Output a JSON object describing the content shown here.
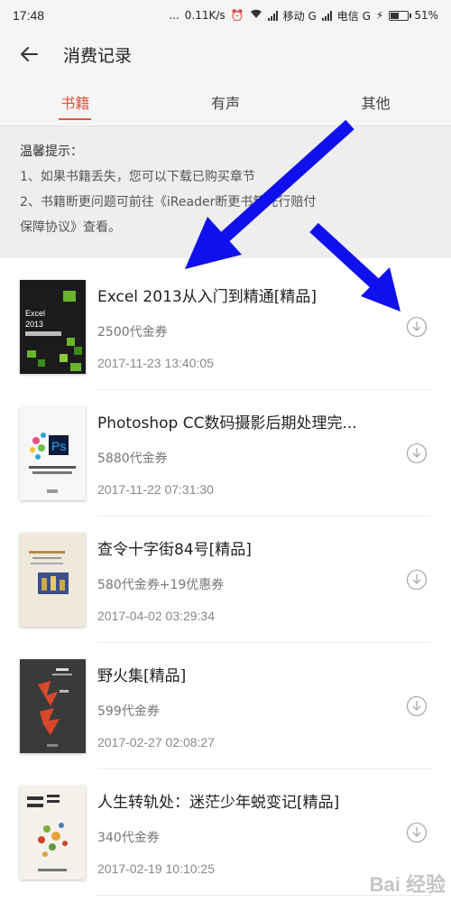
{
  "status_bar": {
    "time": "17:48",
    "dots": "...",
    "speed": "0.11K/s",
    "carrier1": "移动 G",
    "carrier2": "电信 G",
    "battery": "51%",
    "battery_level": 0.51
  },
  "header": {
    "title": "消费记录"
  },
  "tabs": [
    {
      "label": "书籍",
      "active": true
    },
    {
      "label": "有声",
      "active": false
    },
    {
      "label": "其他",
      "active": false
    }
  ],
  "notice": {
    "title": "温馨提示：",
    "line1": "1、如果书籍丢失，您可以下载已购买章节",
    "line2": "2、书籍断更问题可前往《iReader断更书籍先行赔付",
    "line3": "保障协议》查看。"
  },
  "books": [
    {
      "title": "Excel 2013从入门到精通[精品]",
      "price": "2500代金券",
      "date": "2017-11-23 13:40:05",
      "cover_text": "Excel 2013",
      "cover_sub": "从入门到精通",
      "cover_color": "#1b1b1b"
    },
    {
      "title": "Photoshop CC数码摄影后期处理完...",
      "price": "5880代金券",
      "date": "2017-11-22 07:31:30",
      "cover_text": "Ps",
      "cover_sub": "Photoshop CC 数码摄影",
      "cover_color": "#f7f7f7"
    },
    {
      "title": "查令十字街84号[精品]",
      "price": "580代金券+19优惠券",
      "date": "2017-04-02 03:29:34",
      "cover_text": "查令十字街84号",
      "cover_sub": "84, Charing Cross Road",
      "cover_color": "#efe9dc"
    },
    {
      "title": "野火集[精品]",
      "price": "599代金券",
      "date": "2017-02-27 02:08:27",
      "cover_text": "野火",
      "cover_sub": "野火集",
      "cover_color": "#3a3a3a"
    },
    {
      "title": "人生转轨处：迷茫少年蜕变记[精品]",
      "price": "340代金券",
      "date": "2017-02-19 10:10:25",
      "cover_text": "人生转轨处",
      "cover_sub": "",
      "cover_color": "#f4f1ea"
    }
  ],
  "watermark": "Bai 经验",
  "colors": {
    "accent": "#e8533d",
    "arrow": "#1010ee"
  },
  "icons": {
    "back": "arrow-left-icon",
    "download": "download-circle-icon"
  }
}
